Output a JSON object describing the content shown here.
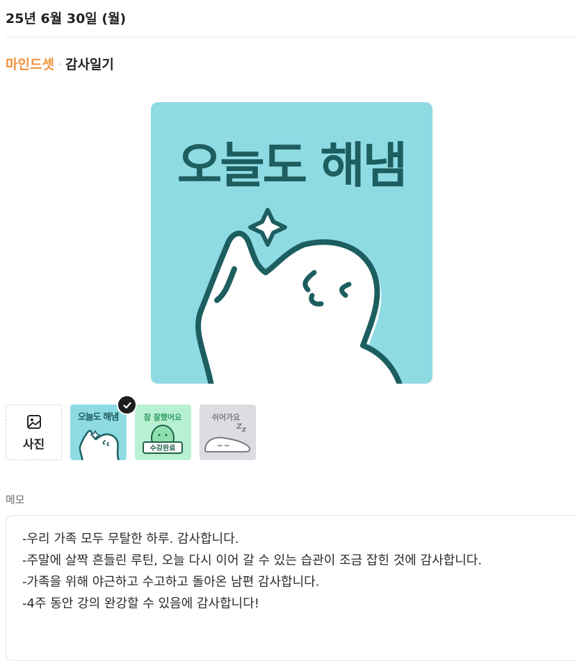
{
  "header": {
    "date": "25년 6월 30일 (월)"
  },
  "breadcrumb": {
    "brand": "마인드셋",
    "separator": "·",
    "category": "감사일기"
  },
  "sticker": {
    "selected": {
      "text": "오늘도 해냄",
      "background": "#8fdbe4",
      "text_color": "#1d5e60"
    }
  },
  "thumbnails": {
    "photo_label": "사진",
    "items": [
      {
        "icon": "sticker-oneuldo-haenaem",
        "text": "오늘도 해냄",
        "background": "#8fdbe4",
        "selected": true
      },
      {
        "icon": "sticker-class-complete",
        "text_top": "참 잘했어요",
        "text_bottom": "수강완료",
        "background": "#b8f0d4",
        "selected": false
      },
      {
        "icon": "sticker-resting",
        "text": "쉬어가요",
        "background": "#dcdce2",
        "selected": false
      }
    ]
  },
  "memo": {
    "label": "메모",
    "lines": [
      "-우리 가족 모두 무탈한 하루. 감사합니다.",
      "-주말에 살짝 흔들린 루틴, 오늘 다시 이어 갈 수 있는 습관이 조금 잡힌 것에 감사합니다.",
      "-가족을 위해 야근하고 수고하고 돌아온 남편 감사합니다.",
      "-4주 동안 강의 완강할 수 있음에 감사합니다!"
    ]
  },
  "colors": {
    "brand_orange": "#f0923a",
    "sticker_teal": "#8fdbe4",
    "outline_dark": "#1d5e60"
  }
}
